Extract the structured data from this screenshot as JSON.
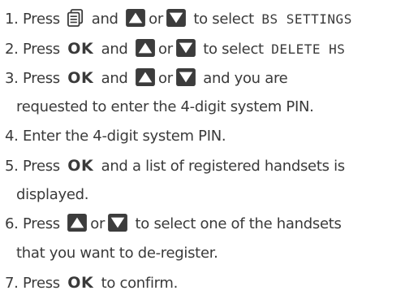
{
  "steps": [
    {
      "line1": {
        "num": "1.",
        "a": "Press",
        "b": "and",
        "c": "or",
        "d": "to select",
        "code": "BS SETTINGS"
      },
      "icons": [
        "phonebook-icon",
        "up-arrow-icon",
        "down-arrow-icon"
      ]
    },
    {
      "line1": {
        "num": "2.",
        "a": "Press",
        "ok": "OK",
        "b": "and",
        "c": "or",
        "d": "to select",
        "code": "DELETE HS"
      }
    },
    {
      "line1": {
        "num": "3.",
        "a": "Press",
        "ok": "OK",
        "b": "and",
        "c": "or",
        "d": "and you are"
      },
      "line2": "requested to enter the 4-digit system PIN."
    },
    {
      "line1": {
        "num": "4.",
        "text": "Enter the 4-digit system PIN."
      }
    },
    {
      "line1": {
        "num": "5.",
        "a": "Press",
        "ok": "OK",
        "b": "and a list of registered handsets is"
      },
      "line2": "displayed."
    },
    {
      "line1": {
        "num": "6.",
        "a": "Press",
        "c": "or",
        "d": "to select one of the handsets"
      },
      "line2": "that you want to de-register."
    },
    {
      "line1": {
        "num": "7.",
        "a": "Press",
        "ok": "OK",
        "b": "to confirm."
      }
    }
  ],
  "colors": {
    "text": "#3a3a3a",
    "icon_fill": "#3c3c3c"
  }
}
